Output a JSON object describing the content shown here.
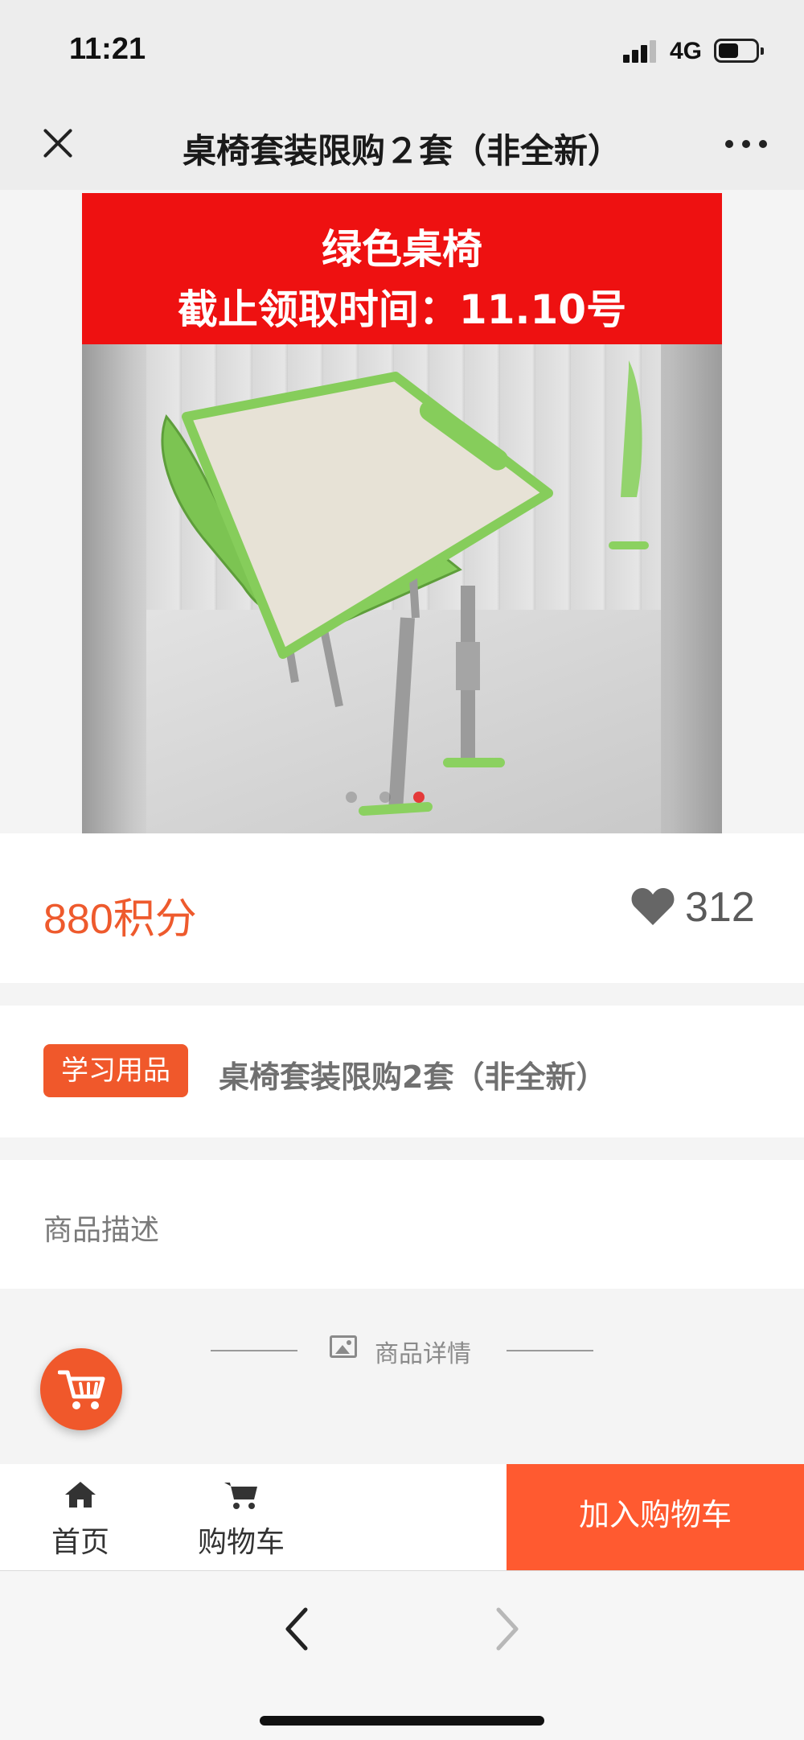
{
  "status_bar": {
    "time": "11:21",
    "network": "4G"
  },
  "nav": {
    "title": "桌椅套装限购２套（非全新）"
  },
  "product": {
    "banner_line1": "绿色桌椅",
    "banner_line2": "截止领取时间：11.10号",
    "carousel": {
      "count": 3,
      "active_index": 3
    },
    "price": "880积分",
    "likes": "312",
    "category": "学习用品",
    "name": "桌椅套装限购2套（非全新）",
    "description_label": "商品描述",
    "detail_label": "商品详情"
  },
  "bottom_nav": {
    "home_label": "首页",
    "cart_label": "购物车",
    "add_to_cart_label": "加入购物车"
  },
  "colors": {
    "accent": "#f0582b",
    "price": "#ee5a2d",
    "banner": "#ee1111",
    "desk_green": "#8bd160"
  },
  "icons": [
    "close-icon",
    "more-icon",
    "heart-icon",
    "image-icon",
    "cart-icon",
    "home-icon",
    "back-arrow-icon",
    "forward-arrow-icon"
  ]
}
